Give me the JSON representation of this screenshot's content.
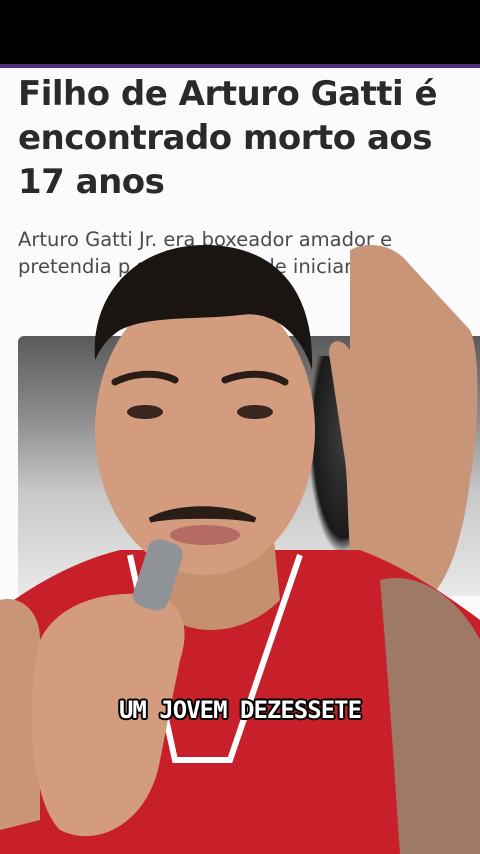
{
  "article": {
    "headline": "Filho de Arturo Gatti é encontrado morto aos 17 anos",
    "subtitle": "Arturo Gatti Jr. era boxeador amador e pretendia p          s Olimpía       es de iniciar                            onal"
  },
  "video": {
    "caption": "UM JOVEM DEZESSETE"
  },
  "colors": {
    "accent": "#4a2d7a",
    "jersey": "#c8202a",
    "background": "#000000"
  }
}
